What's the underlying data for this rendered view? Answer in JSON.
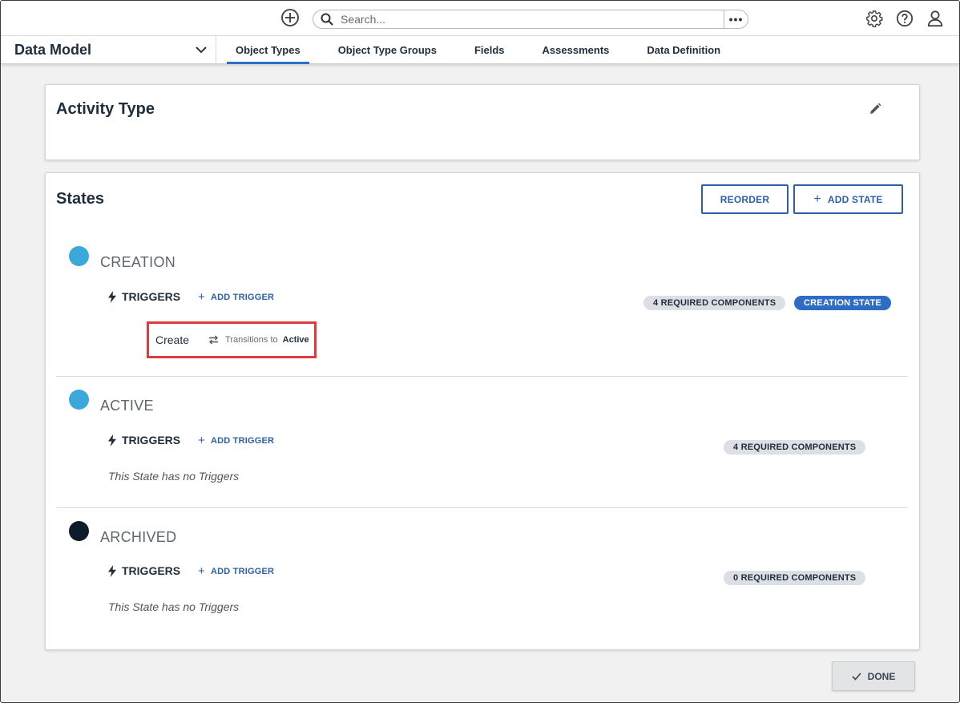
{
  "topbar": {
    "search_placeholder": "Search...",
    "more_label": "•••",
    "icons": [
      "add-circle-icon",
      "search-icon",
      "settings-gear-icon",
      "help-icon",
      "user-profile-icon"
    ]
  },
  "nav": {
    "app_name": "Data Model",
    "tabs": [
      {
        "label": "Object Types",
        "active": true
      },
      {
        "label": "Object Type Groups",
        "active": false
      },
      {
        "label": "Fields",
        "active": false
      },
      {
        "label": "Assessments",
        "active": false
      },
      {
        "label": "Data Definition",
        "active": false
      }
    ]
  },
  "object_type": {
    "title": "Activity Type"
  },
  "states_section": {
    "title": "States",
    "reorder_label": "REORDER",
    "add_state_label": "ADD STATE",
    "triggers_label": "TRIGGERS",
    "add_trigger_label": "ADD TRIGGER",
    "states": [
      {
        "name": "CREATION",
        "dot_color": "#3aa8d8",
        "required_components": "4 REQUIRED COMPONENTS",
        "creation_badge": "CREATION STATE",
        "trigger": {
          "name": "Create",
          "transitions_label": "Transitions to",
          "target": "Active"
        }
      },
      {
        "name": "ACTIVE",
        "dot_color": "#3aa8d8",
        "required_components": "4 REQUIRED COMPONENTS",
        "no_triggers": "This State has no Triggers"
      },
      {
        "name": "ARCHIVED",
        "dot_color": "#0e1b2b",
        "required_components": "0 REQUIRED COMPONENTS",
        "no_triggers": "This State has no Triggers"
      }
    ]
  },
  "done_label": "DONE",
  "colors": {
    "accent": "#2d5fa8",
    "highlight_border": "#e0393e",
    "creation_badge_bg": "#2d6cc4"
  }
}
